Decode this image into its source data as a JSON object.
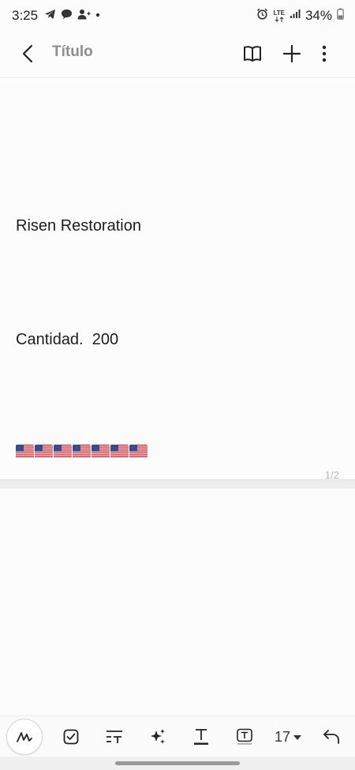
{
  "status_bar": {
    "time": "3:25",
    "battery": "34%",
    "network": "LTE"
  },
  "header": {
    "title": "Título",
    "icons": [
      "back-arrow-icon",
      "book-icon",
      "plus-icon",
      "more-vert-icon"
    ]
  },
  "note": {
    "lines": [
      "Risen Restoration",
      "Cantidad.  200"
    ],
    "flag_count": 7,
    "page_indicator": "1/2"
  },
  "toolbar": {
    "font_size": "17",
    "icons": [
      "handwriting-icon",
      "checkbox-icon",
      "text-format-icon",
      "ai-sparkle-icon",
      "text-color-icon",
      "text-box-icon",
      "undo-icon"
    ]
  },
  "colors": {
    "flag_red": "#c6262e",
    "flag_blue": "#3a4a8a",
    "title_gray": "#8e8e8e"
  }
}
